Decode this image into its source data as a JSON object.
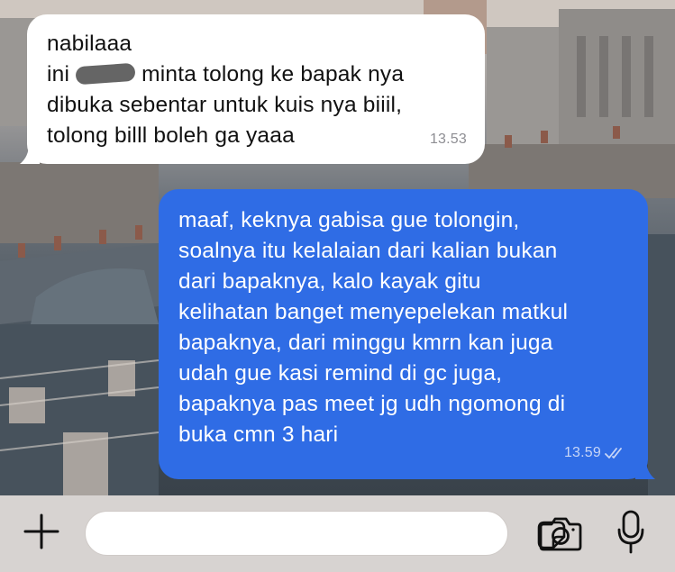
{
  "chat": {
    "incoming": {
      "lines": [
        "nabilaaa",
        "minta tolong ke bapak nya",
        "dibuka sebentar untuk kuis nya biiil,",
        "tolong billl boleh ga yaaa"
      ],
      "prefix": "ini",
      "time": "13.53"
    },
    "outgoing": {
      "lines": [
        "maaf, keknya gabisa gue tolongin,",
        "soalnya itu kelalaian dari kalian bukan",
        "dari bapaknya, kalo kayak gitu",
        "kelihatan banget menyepelekan matkul",
        "bapaknya, dari minggu kmrn kan juga",
        "udah gue kasi remind di gc juga,",
        "bapaknya pas meet jg udh ngomong di",
        "buka cmn 3 hari"
      ],
      "time": "13.59",
      "status_icon": "double-check-icon"
    }
  },
  "input_bar": {
    "message_value": "",
    "icons": [
      "plus-icon",
      "sticker-icon",
      "camera-icon",
      "microphone-icon"
    ]
  },
  "colors": {
    "incoming_bubble": "#ffffff",
    "outgoing_bubble": "#2f6ce5",
    "input_bar": "#d7d3d1"
  }
}
